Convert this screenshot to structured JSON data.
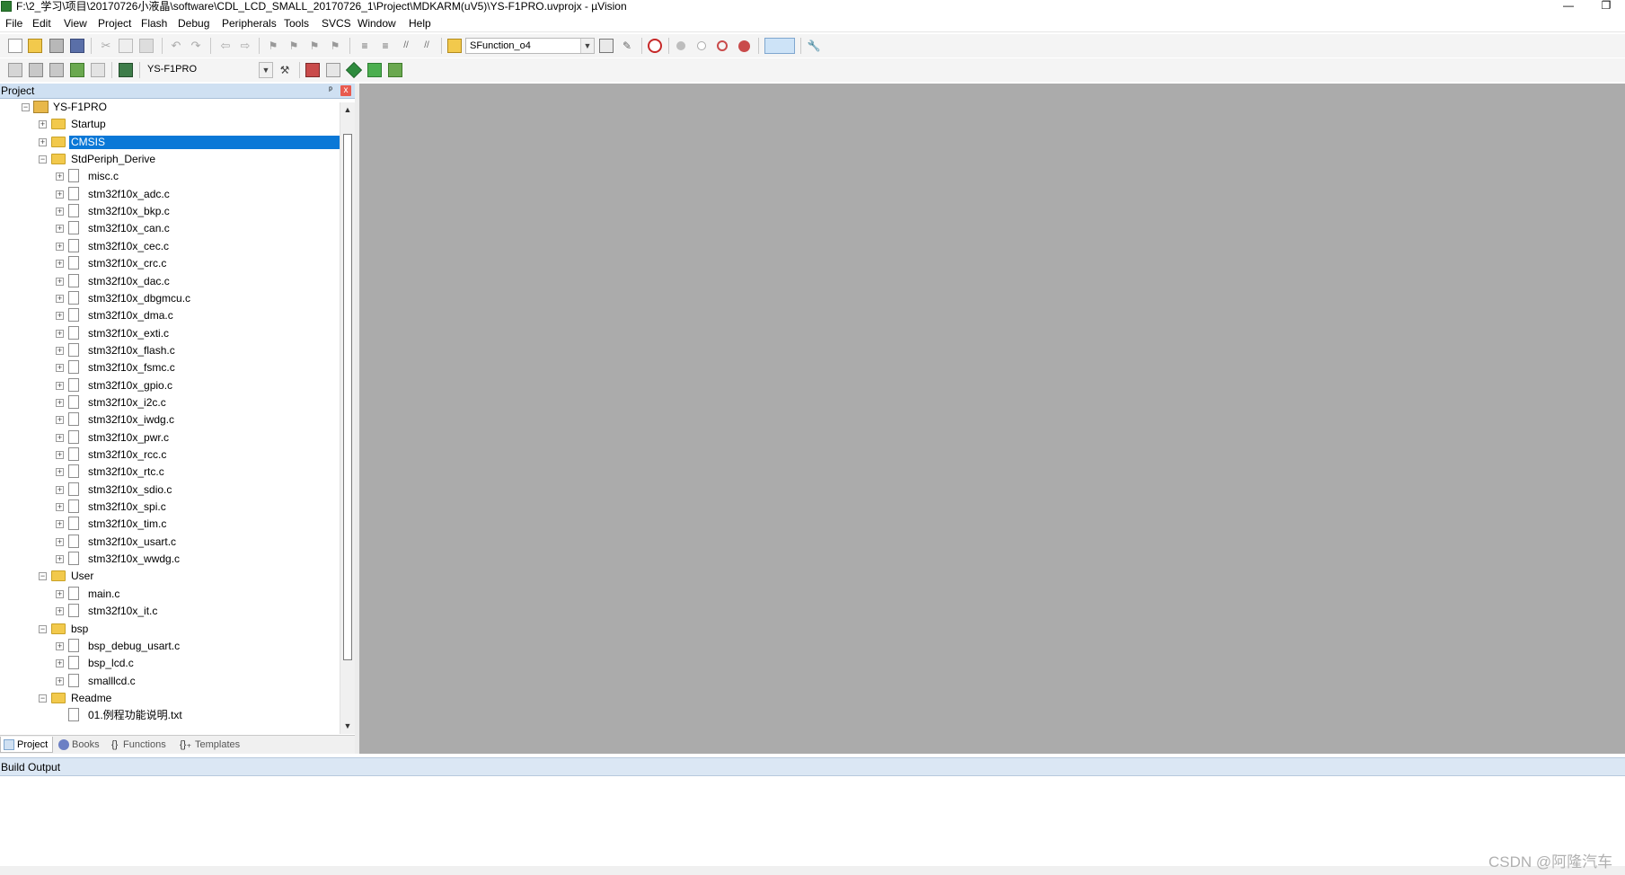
{
  "window": {
    "title": "F:\\2_学习\\项目\\20170726小液晶\\software\\CDL_LCD_SMALL_20170726_1\\Project\\MDKARM(uV5)\\YS-F1PRO.uvprojx - µVision",
    "minimize": "—",
    "restore": "❐"
  },
  "menu": [
    "File",
    "Edit",
    "View",
    "Project",
    "Flash",
    "Debug",
    "Peripherals",
    "Tools",
    "SVCS",
    "Window",
    "Help"
  ],
  "toolbar": {
    "function_combo": "SFunction_o4",
    "target_combo": "YS-F1PRO"
  },
  "project_panel": {
    "title": "Project",
    "pin": "ᵖ",
    "close": "x"
  },
  "tree": [
    {
      "label": "YS-F1PRO",
      "type": "root",
      "level": 0,
      "expander": "−"
    },
    {
      "label": "Startup",
      "type": "folder",
      "level": 1,
      "expander": "+"
    },
    {
      "label": "CMSIS",
      "type": "folder",
      "level": 1,
      "expander": "+",
      "selected": true
    },
    {
      "label": "StdPeriph_Derive",
      "type": "folder",
      "level": 1,
      "expander": "−"
    },
    {
      "label": "misc.c",
      "type": "file",
      "level": 2,
      "expander": "+"
    },
    {
      "label": "stm32f10x_adc.c",
      "type": "file",
      "level": 2,
      "expander": "+"
    },
    {
      "label": "stm32f10x_bkp.c",
      "type": "file",
      "level": 2,
      "expander": "+"
    },
    {
      "label": "stm32f10x_can.c",
      "type": "file",
      "level": 2,
      "expander": "+"
    },
    {
      "label": "stm32f10x_cec.c",
      "type": "file",
      "level": 2,
      "expander": "+"
    },
    {
      "label": "stm32f10x_crc.c",
      "type": "file",
      "level": 2,
      "expander": "+"
    },
    {
      "label": "stm32f10x_dac.c",
      "type": "file",
      "level": 2,
      "expander": "+"
    },
    {
      "label": "stm32f10x_dbgmcu.c",
      "type": "file",
      "level": 2,
      "expander": "+"
    },
    {
      "label": "stm32f10x_dma.c",
      "type": "file",
      "level": 2,
      "expander": "+"
    },
    {
      "label": "stm32f10x_exti.c",
      "type": "file",
      "level": 2,
      "expander": "+"
    },
    {
      "label": "stm32f10x_flash.c",
      "type": "file",
      "level": 2,
      "expander": "+"
    },
    {
      "label": "stm32f10x_fsmc.c",
      "type": "file",
      "level": 2,
      "expander": "+"
    },
    {
      "label": "stm32f10x_gpio.c",
      "type": "file",
      "level": 2,
      "expander": "+"
    },
    {
      "label": "stm32f10x_i2c.c",
      "type": "file",
      "level": 2,
      "expander": "+"
    },
    {
      "label": "stm32f10x_iwdg.c",
      "type": "file",
      "level": 2,
      "expander": "+"
    },
    {
      "label": "stm32f10x_pwr.c",
      "type": "file",
      "level": 2,
      "expander": "+"
    },
    {
      "label": "stm32f10x_rcc.c",
      "type": "file",
      "level": 2,
      "expander": "+"
    },
    {
      "label": "stm32f10x_rtc.c",
      "type": "file",
      "level": 2,
      "expander": "+"
    },
    {
      "label": "stm32f10x_sdio.c",
      "type": "file",
      "level": 2,
      "expander": "+"
    },
    {
      "label": "stm32f10x_spi.c",
      "type": "file",
      "level": 2,
      "expander": "+"
    },
    {
      "label": "stm32f10x_tim.c",
      "type": "file",
      "level": 2,
      "expander": "+"
    },
    {
      "label": "stm32f10x_usart.c",
      "type": "file",
      "level": 2,
      "expander": "+"
    },
    {
      "label": "stm32f10x_wwdg.c",
      "type": "file",
      "level": 2,
      "expander": "+"
    },
    {
      "label": "User",
      "type": "folder",
      "level": 1,
      "expander": "−"
    },
    {
      "label": "main.c",
      "type": "file",
      "level": 2,
      "expander": "+"
    },
    {
      "label": "stm32f10x_it.c",
      "type": "file",
      "level": 2,
      "expander": "+"
    },
    {
      "label": "bsp",
      "type": "folder",
      "level": 1,
      "expander": "−"
    },
    {
      "label": "bsp_debug_usart.c",
      "type": "file",
      "level": 2,
      "expander": "+"
    },
    {
      "label": "bsp_lcd.c",
      "type": "file",
      "level": 2,
      "expander": "+"
    },
    {
      "label": "smalllcd.c",
      "type": "file",
      "level": 2,
      "expander": "+"
    },
    {
      "label": "Readme",
      "type": "folder",
      "level": 1,
      "expander": "−"
    },
    {
      "label": "01.例程功能说明.txt",
      "type": "file",
      "level": 2,
      "expander": ""
    }
  ],
  "tabs": [
    {
      "label": "Project",
      "active": true
    },
    {
      "label": "Books",
      "active": false
    },
    {
      "label": "Functions",
      "active": false
    },
    {
      "label": "Templates",
      "active": false
    }
  ],
  "build_output": {
    "title": "Build Output"
  },
  "watermark": "CSDN @阿隆汽车",
  "colors": {
    "selection": "#0a78d7",
    "editor_bg": "#ababab",
    "panel_header": "#cfe0f2"
  }
}
